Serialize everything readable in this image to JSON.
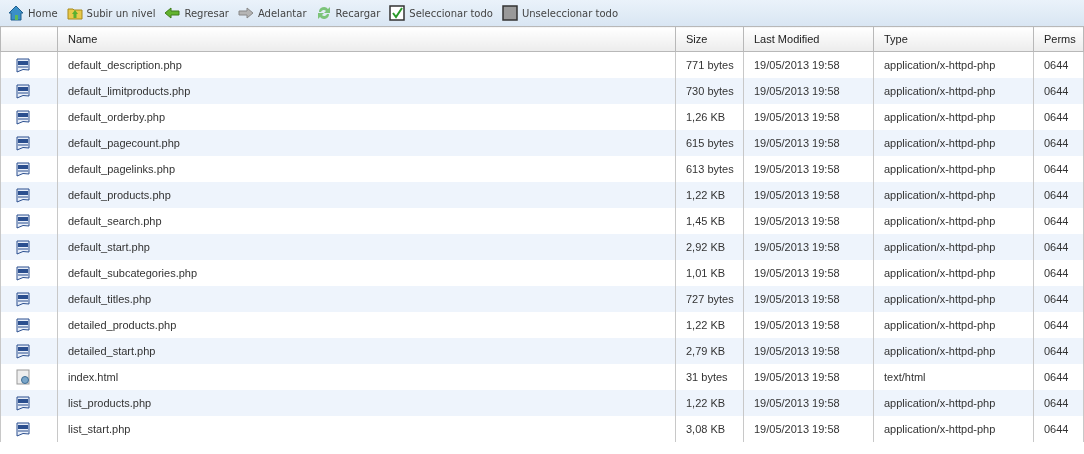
{
  "toolbar": [
    {
      "kind": "home",
      "label": "Home"
    },
    {
      "kind": "up",
      "label": "Subir un nivel"
    },
    {
      "kind": "back",
      "label": "Regresar"
    },
    {
      "kind": "forward",
      "label": "Adelantar"
    },
    {
      "kind": "reload",
      "label": "Recargar"
    },
    {
      "kind": "selectall",
      "label": "Seleccionar todo"
    },
    {
      "kind": "deselectall",
      "label": "Unseleccionar todo"
    }
  ],
  "table": {
    "columns": [
      "Name",
      "Size",
      "Last Modified",
      "Type",
      "Perms"
    ],
    "rows": [
      {
        "kind": "php",
        "name": "default_description.php",
        "size": "771 bytes",
        "modified": "19/05/2013 19:58",
        "type": "application/x-httpd-php",
        "perms": "0644"
      },
      {
        "kind": "php",
        "name": "default_limitproducts.php",
        "size": "730 bytes",
        "modified": "19/05/2013 19:58",
        "type": "application/x-httpd-php",
        "perms": "0644"
      },
      {
        "kind": "php",
        "name": "default_orderby.php",
        "size": "1,26 KB",
        "modified": "19/05/2013 19:58",
        "type": "application/x-httpd-php",
        "perms": "0644"
      },
      {
        "kind": "php",
        "name": "default_pagecount.php",
        "size": "615 bytes",
        "modified": "19/05/2013 19:58",
        "type": "application/x-httpd-php",
        "perms": "0644"
      },
      {
        "kind": "php",
        "name": "default_pagelinks.php",
        "size": "613 bytes",
        "modified": "19/05/2013 19:58",
        "type": "application/x-httpd-php",
        "perms": "0644"
      },
      {
        "kind": "php",
        "name": "default_products.php",
        "size": "1,22 KB",
        "modified": "19/05/2013 19:58",
        "type": "application/x-httpd-php",
        "perms": "0644"
      },
      {
        "kind": "php",
        "name": "default_search.php",
        "size": "1,45 KB",
        "modified": "19/05/2013 19:58",
        "type": "application/x-httpd-php",
        "perms": "0644"
      },
      {
        "kind": "php",
        "name": "default_start.php",
        "size": "2,92 KB",
        "modified": "19/05/2013 19:58",
        "type": "application/x-httpd-php",
        "perms": "0644"
      },
      {
        "kind": "php",
        "name": "default_subcategories.php",
        "size": "1,01 KB",
        "modified": "19/05/2013 19:58",
        "type": "application/x-httpd-php",
        "perms": "0644"
      },
      {
        "kind": "php",
        "name": "default_titles.php",
        "size": "727 bytes",
        "modified": "19/05/2013 19:58",
        "type": "application/x-httpd-php",
        "perms": "0644"
      },
      {
        "kind": "php",
        "name": "detailed_products.php",
        "size": "1,22 KB",
        "modified": "19/05/2013 19:58",
        "type": "application/x-httpd-php",
        "perms": "0644"
      },
      {
        "kind": "php",
        "name": "detailed_start.php",
        "size": "2,79 KB",
        "modified": "19/05/2013 19:58",
        "type": "application/x-httpd-php",
        "perms": "0644"
      },
      {
        "kind": "html",
        "name": "index.html",
        "size": "31 bytes",
        "modified": "19/05/2013 19:58",
        "type": "text/html",
        "perms": "0644"
      },
      {
        "kind": "php",
        "name": "list_products.php",
        "size": "1,22 KB",
        "modified": "19/05/2013 19:58",
        "type": "application/x-httpd-php",
        "perms": "0644"
      },
      {
        "kind": "php",
        "name": "list_start.php",
        "size": "3,08 KB",
        "modified": "19/05/2013 19:58",
        "type": "application/x-httpd-php",
        "perms": "0644"
      }
    ]
  }
}
